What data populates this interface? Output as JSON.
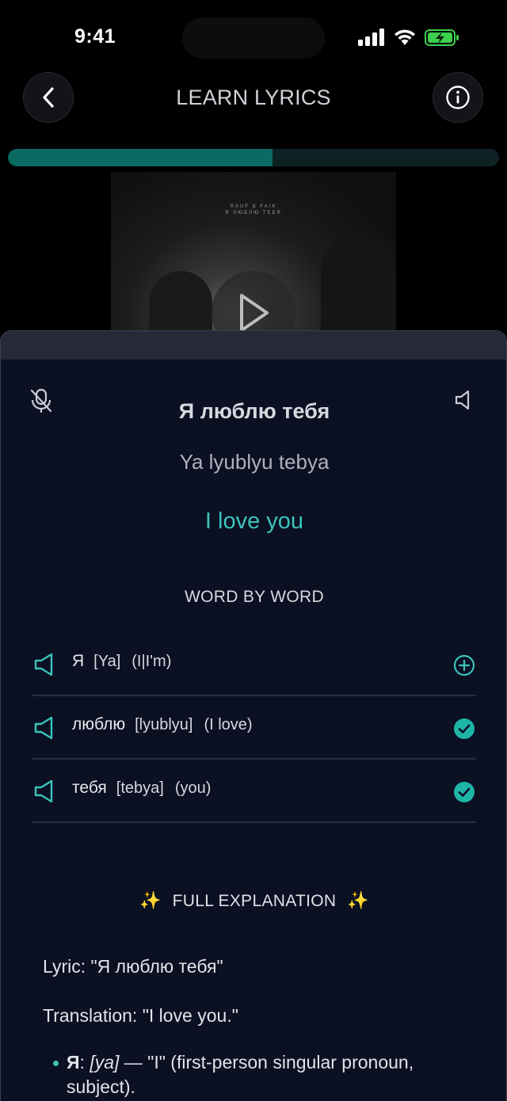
{
  "status_bar": {
    "time": "9:41"
  },
  "header": {
    "title": "LEARN LYRICS"
  },
  "progress": {
    "fraction": 0.539
  },
  "album": {
    "cover_text": "RAUF & FAIK\nЯ ЛЮБЛЮ ТЕБЯ"
  },
  "lyric": {
    "original": "Я люблю тебя",
    "transliteration": "Ya lyublyu tebya",
    "translation": "I love you"
  },
  "word_by_word": {
    "title": "WORD BY WORD",
    "words": [
      {
        "word": "Я",
        "transliteration": "[Ya]",
        "meaning": "(I|I'm)",
        "status": "add"
      },
      {
        "word": "люблю",
        "transliteration": "[lyublyu]",
        "meaning": "(I love)",
        "status": "learned"
      },
      {
        "word": "тебя",
        "transliteration": "[tebya]",
        "meaning": "(you)",
        "status": "learned"
      }
    ]
  },
  "explanation": {
    "title": "FULL EXPLANATION",
    "sparkle": "✨",
    "lyric_line": "Lyric: \"Я люблю тебя\"",
    "translation_line": "Translation: \"I love you.\"",
    "bullets": [
      {
        "term": "Я",
        "pron": "[ya]",
        "desc": " — \"I\" (first-person singular pronoun, subject)."
      }
    ]
  },
  "colors": {
    "accent": "#3bc4bb",
    "progress": "#0b6a62",
    "sheet_bg": "#0b1022"
  }
}
